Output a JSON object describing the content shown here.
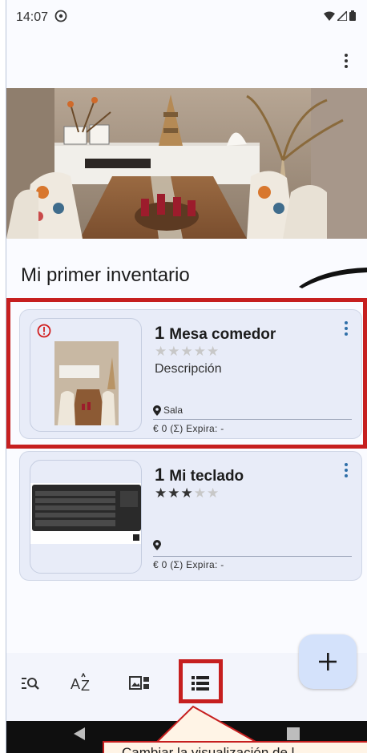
{
  "status_bar": {
    "time": "14:07"
  },
  "inventory": {
    "title": "Mi primer inventario"
  },
  "items": [
    {
      "quantity": "1",
      "name": "Mesa comedor",
      "rating": 0,
      "description": "Descripción",
      "location": "Sala",
      "meta": "€ 0  (Σ)  Expira: -",
      "alert": true
    },
    {
      "quantity": "1",
      "name": "Mi teclado",
      "rating": 3,
      "description": "",
      "location": "",
      "meta": "€ 0  (Σ)  Expira: -",
      "alert": false
    }
  ],
  "bottom_nav": {
    "icons": [
      "filter-search-icon",
      "sort-az-icon",
      "view-gallery-icon",
      "view-list-icon"
    ]
  },
  "fab": {
    "icon": "plus-icon"
  },
  "callout": {
    "text": "Cambiar la visualización de l"
  },
  "colors": {
    "highlight": "#c61f1f",
    "card_bg": "#e8ecf8",
    "fab_bg": "#d4e2fb"
  }
}
